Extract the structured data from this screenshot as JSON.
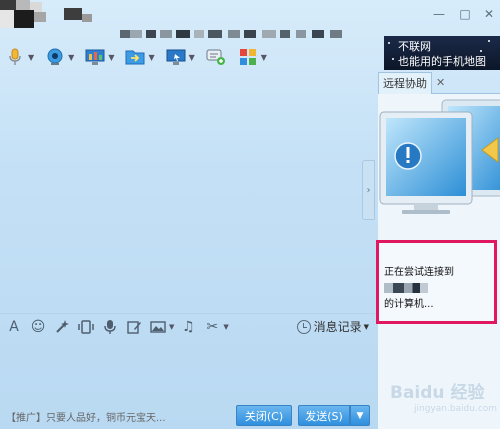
{
  "titlebar": {
    "minimize_glyph": "—",
    "maximize_glyph": "□",
    "close_glyph": "✕"
  },
  "toolbar": {
    "tools": [
      {
        "icon": "microphone-icon"
      },
      {
        "icon": "video-camera-icon"
      },
      {
        "icon": "remote-desktop-icon"
      },
      {
        "icon": "send-file-icon"
      },
      {
        "icon": "screen-share-icon"
      },
      {
        "icon": "new-chat-icon"
      },
      {
        "icon": "apps-grid-icon"
      }
    ],
    "dropdown_glyph": "▼"
  },
  "ad": {
    "line1": "不联网",
    "line2": "也能用的手机地图"
  },
  "remote_panel": {
    "tab_label": "远程协助",
    "tab_close": "✕",
    "status_prefix": "正在尝试连接到",
    "status_suffix": "的计算机..."
  },
  "input_toolbar": {
    "font_glyph": "A",
    "emoji_glyph": "☺",
    "music_glyph": "♫",
    "scissors_glyph": "✂",
    "history_label": "消息记录",
    "dropdown_glyph": "▼"
  },
  "bottom": {
    "promo": "【推广】只要人品好，铜币元宝天...",
    "close_label": "关闭(C)",
    "send_label": "发送(S)",
    "send_dropdown_glyph": "▼"
  },
  "watermark": {
    "brand": "Baidu 经验",
    "url": "jingyan.baidu.com"
  },
  "colors": {
    "accent_blue": "#2f8fde",
    "highlight_border": "#e0185f",
    "background": "#c4e0f6"
  }
}
